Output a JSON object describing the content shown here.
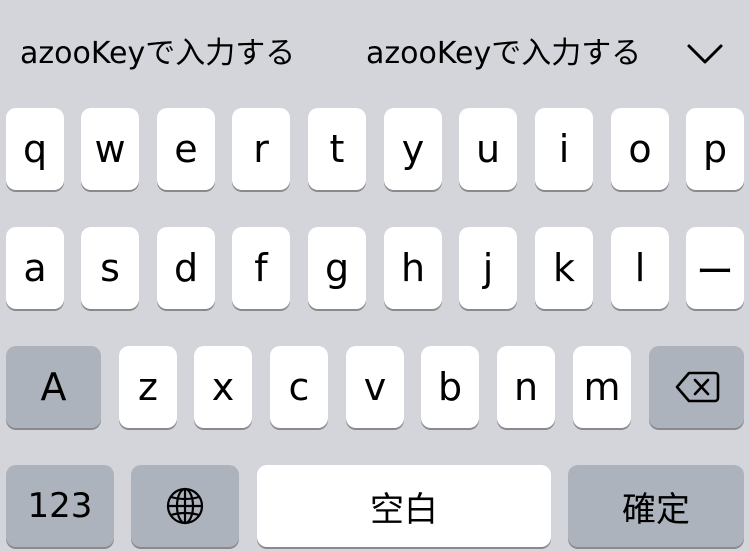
{
  "candidates": {
    "items": [
      "azooKeyで入力する",
      "azooKeyで入力する"
    ],
    "expand_icon": "chevron-down-icon"
  },
  "keyboard": {
    "row1": [
      "q",
      "w",
      "e",
      "r",
      "t",
      "y",
      "u",
      "i",
      "o",
      "p"
    ],
    "row2": [
      "a",
      "s",
      "d",
      "f",
      "g",
      "h",
      "j",
      "k",
      "l",
      "ー"
    ],
    "row3": {
      "shift_label": "A",
      "letters": [
        "z",
        "x",
        "c",
        "v",
        "b",
        "n",
        "m"
      ],
      "delete_icon": "backspace-icon"
    },
    "row4": {
      "numbers_label": "123",
      "globe_icon": "globe-icon",
      "space_label": "空白",
      "confirm_label": "確定"
    }
  },
  "colors": {
    "keyboard_background": "#d3d5da",
    "key_background": "#ffffff",
    "function_key_background": "#adb3bc",
    "key_shadow": "#898a8d"
  }
}
